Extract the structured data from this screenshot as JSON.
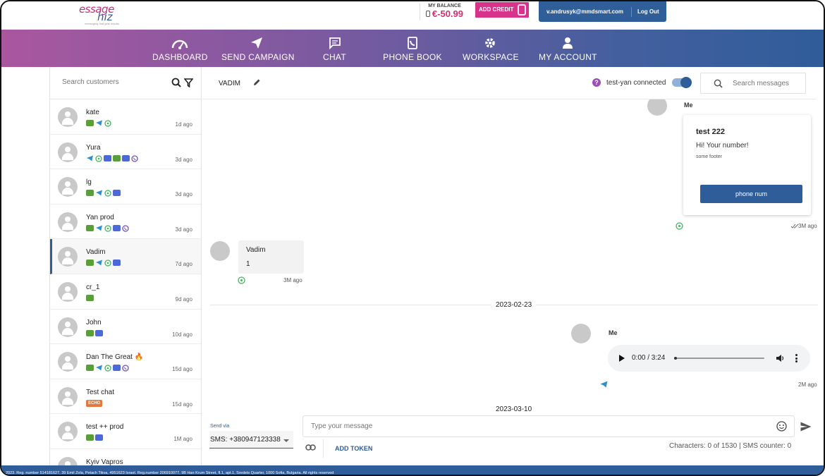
{
  "header": {
    "logo": {
      "line1": "essage",
      "line2": "hiz",
      "tagline": "messaging that gets results"
    },
    "balance_label": "MY BALANCE",
    "balance_value": "€-50.99",
    "add_credit": "ADD CREDIT",
    "user_email": "v.andrusyk@mmdsmart.com",
    "logout": "Log Out"
  },
  "nav": {
    "items": [
      {
        "label": "DASHBOARD",
        "icon": "speedometer-icon"
      },
      {
        "label": "SEND CAMPAIGN",
        "icon": "paper-plane-icon"
      },
      {
        "label": "CHAT",
        "icon": "chat-bubble-icon"
      },
      {
        "label": "PHONE BOOK",
        "icon": "phonebook-icon"
      },
      {
        "label": "WORKSPACE",
        "icon": "gear-icon"
      },
      {
        "label": "MY ACCOUNT",
        "icon": "person-icon"
      }
    ]
  },
  "sidebar": {
    "search_placeholder": "Search customers",
    "customers": [
      {
        "name": "kate",
        "time": "1d ago",
        "channels": [
          "sms",
          "tg",
          "wa"
        ]
      },
      {
        "name": "Yura",
        "time": "3d ago",
        "channels": [
          "tg",
          "wa",
          "rcs",
          "sms",
          "rcs",
          "vb"
        ]
      },
      {
        "name": "lg",
        "time": "3d ago",
        "channels": [
          "sms",
          "tg",
          "wa",
          "rcs"
        ]
      },
      {
        "name": "Yan prod",
        "time": "3d ago",
        "channels": [
          "sms",
          "tg",
          "wa",
          "rcs",
          "vb"
        ]
      },
      {
        "name": "Vadim",
        "time": "7d ago",
        "channels": [
          "sms",
          "tg",
          "wa",
          "rcs"
        ],
        "active": true
      },
      {
        "name": "cr_1",
        "time": "9d ago",
        "channels": [
          "sms"
        ]
      },
      {
        "name": "John",
        "time": "10d ago",
        "channels": [
          "sms",
          "rcs"
        ]
      },
      {
        "name": "Dan The Great 🔥",
        "time": "15d ago",
        "channels": [
          "sms",
          "tg",
          "wa",
          "rcs",
          "vb"
        ]
      },
      {
        "name": "Test chat",
        "time": "15d ago",
        "channels": [],
        "badge": "ECHO"
      },
      {
        "name": "test ++ prod",
        "time": "1M ago",
        "channels": [
          "sms",
          "rcs"
        ]
      },
      {
        "name": "Kyiv Vapros",
        "time": "",
        "channels": []
      }
    ]
  },
  "chat": {
    "contact_name": "VADIM",
    "connection_text": "test-yan connected",
    "search_placeholder": "Search messages",
    "messages": {
      "card": {
        "sender": "Me",
        "title": "test 222",
        "body": "Hi! Your number!",
        "footer": "some footer",
        "button": "phone num",
        "time": "3M ago"
      },
      "incoming": {
        "sender": "Vadim",
        "text": "1",
        "time": "3M ago"
      },
      "date1": "2023-02-23",
      "audio": {
        "sender": "Me",
        "time_display": "0:00 / 3:24",
        "time": "2M ago",
        "progress": 0
      },
      "date2": "2023-03-10"
    }
  },
  "composer": {
    "send_via_label": "Send via",
    "send_via_value": "SMS: +380947123338",
    "message_placeholder": "Type your message",
    "add_token": "ADD TOKEN",
    "counter": "Characters: 0 of 1530 | SMS counter: 0"
  },
  "footer": {
    "text": "2023. Reg. number 514181627, 39 Emil Zola, Petach Tikva, 4951623 Israel. Reg.number 206910077, 9B Han Krum Street, fl.1, apt.1, Sredets Quarter, 1000 Sofia, Bulgaria. All rights reserved"
  },
  "colors": {
    "brand_blue": "#2f5d9a",
    "brand_pink": "#d8338a",
    "sms": "#5a9e3a",
    "rcs": "#4d69d8",
    "telegram": "#2f8fd1",
    "whatsapp": "#3fb55a",
    "viber": "#6e4fc4"
  }
}
